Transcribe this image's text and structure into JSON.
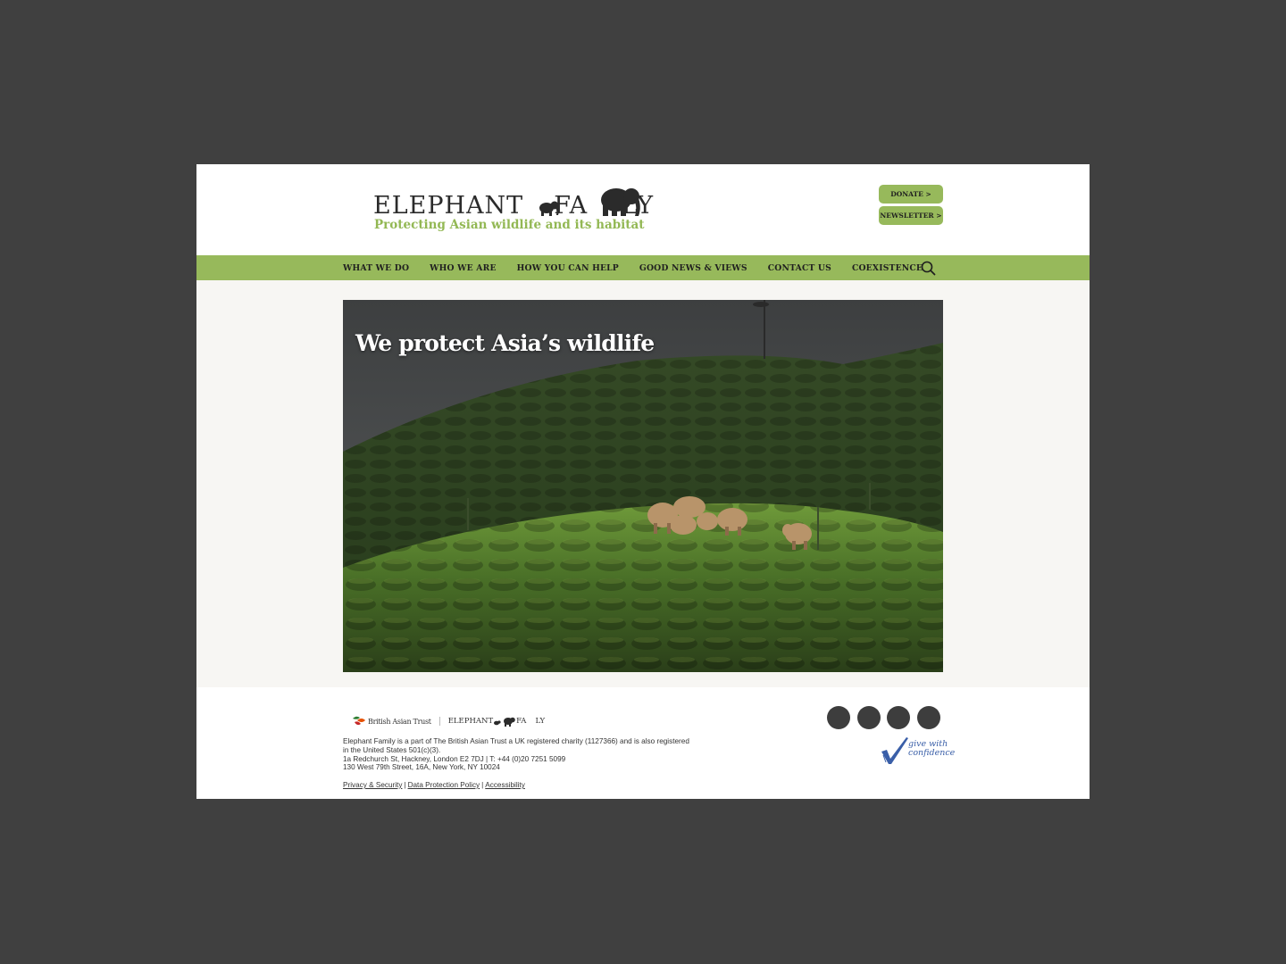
{
  "header": {
    "logo_text_left": "ELEPHANT",
    "logo_text_mid": "FA",
    "logo_text_right": "LY",
    "tagline": "Protecting Asian wildlife and its habitat",
    "donate_label": "DONATE >",
    "newsletter_label": "NEWSLETTER >"
  },
  "nav": {
    "items": [
      {
        "label": "WHAT WE DO"
      },
      {
        "label": "WHO WE ARE"
      },
      {
        "label": "HOW YOU CAN HELP"
      },
      {
        "label": "GOOD NEWS & VIEWS"
      },
      {
        "label": "CONTACT US"
      },
      {
        "label": "COEXISTENCE"
      }
    ],
    "search_icon": "search-icon"
  },
  "hero": {
    "title": "We protect Asia’s wildlife"
  },
  "footer": {
    "bat_label": "British Asian Trust",
    "ef_label_left": "ELEPHANT",
    "ef_label_mid": "FA",
    "ef_label_right": "LY",
    "text_lines": [
      "Elephant Family is a part of The British Asian Trust a UK registered charity (1127366) and is also registered",
      "in the United States 501(c)(3).",
      "1a Redchurch St, Hackney, London E2 7DJ | T: +44 (0)20 7251 5099",
      "130 West 79th Street, 16A, New York, NY 10024"
    ],
    "links": [
      {
        "label": "Privacy & Security"
      },
      {
        "label": "Data Protection Policy"
      },
      {
        "label": "Accessibility"
      }
    ],
    "link_separator": "|",
    "gwc_line1": "give with",
    "gwc_line2": "confidence"
  },
  "colors": {
    "accent_green": "#97b95b",
    "tagline_green": "#93b854",
    "page_backdrop": "#404040",
    "social_circle": "#3d3d3d"
  }
}
